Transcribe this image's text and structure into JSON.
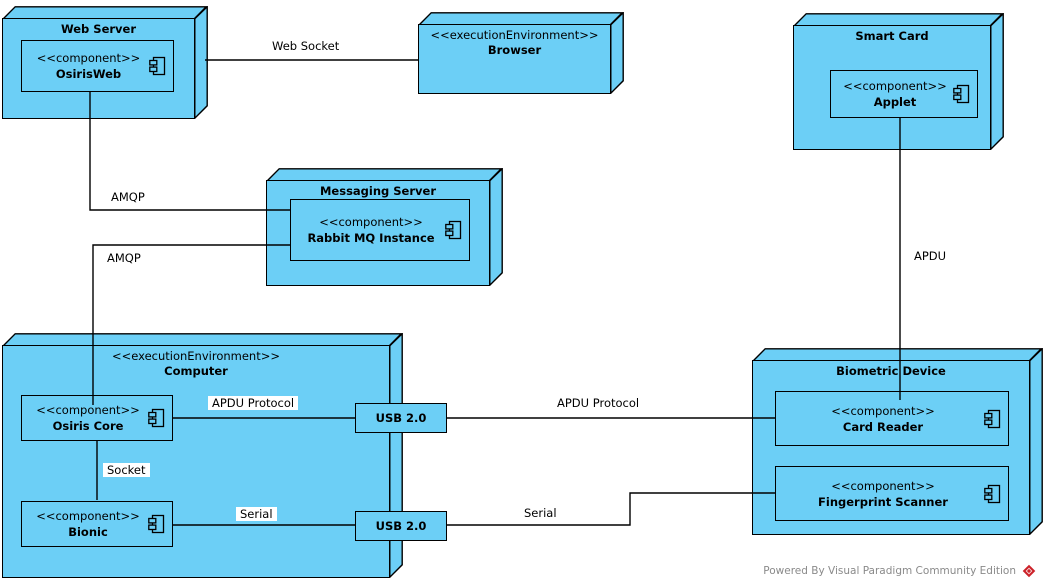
{
  "diagram": {
    "type": "uml-deployment-diagram",
    "watermark": "Powered By Visual Paradigm Community Edition",
    "colors": {
      "node_fill": "#6CCFF6",
      "node_border": "#000000",
      "background": "#FFFFFF",
      "watermark_text": "#8A8A8A",
      "watermark_logo": "#CC2229"
    }
  },
  "nodes": [
    {
      "id": "web-server",
      "stereotype": "",
      "name": "Web Server",
      "component": {
        "stereotype": "<<component>>",
        "name": "OsirisWeb"
      }
    },
    {
      "id": "browser",
      "stereotype": "<<executionEnvironment>>",
      "name": "Browser",
      "component": null
    },
    {
      "id": "smart-card",
      "stereotype": "",
      "name": "Smart Card",
      "component": {
        "stereotype": "<<component>>",
        "name": "Applet"
      }
    },
    {
      "id": "messaging-server",
      "stereotype": "",
      "name": "Messaging Server",
      "component": {
        "stereotype": "<<component>>",
        "name": "Rabbit MQ Instance"
      }
    },
    {
      "id": "computer",
      "stereotype": "<<executionEnvironment>>",
      "name": "Computer",
      "components": [
        {
          "stereotype": "<<component>>",
          "name": "Osiris Core"
        },
        {
          "stereotype": "<<component>>",
          "name": "Bionic"
        }
      ]
    },
    {
      "id": "biometric-device",
      "stereotype": "",
      "name": "Biometric Device",
      "components": [
        {
          "stereotype": "<<component>>",
          "name": "Card Reader"
        },
        {
          "stereotype": "<<component>>",
          "name": "Fingerprint Scanner"
        }
      ]
    }
  ],
  "artifacts": [
    {
      "id": "usb-top",
      "label": "USB 2.0"
    },
    {
      "id": "usb-bottom",
      "label": "USB 2.0"
    }
  ],
  "connections": [
    {
      "id": "web-socket",
      "label": "Web Socket",
      "from": "web-server",
      "to": "browser"
    },
    {
      "id": "amqp-upper",
      "label": "AMQP",
      "from": "web-server",
      "to": "messaging-server"
    },
    {
      "id": "amqp-lower",
      "label": "AMQP",
      "from": "messaging-server",
      "to": "computer"
    },
    {
      "id": "apdu",
      "label": "APDU",
      "from": "smart-card",
      "to": "biometric-device"
    },
    {
      "id": "apdu-protocol-left",
      "label": "APDU Protocol",
      "from": "osiris-core",
      "to": "usb-top"
    },
    {
      "id": "apdu-protocol-right",
      "label": "APDU Protocol",
      "from": "usb-top",
      "to": "card-reader"
    },
    {
      "id": "socket",
      "label": "Socket",
      "from": "osiris-core",
      "to": "bionic"
    },
    {
      "id": "serial-left",
      "label": "Serial",
      "from": "bionic",
      "to": "usb-bottom"
    },
    {
      "id": "serial-right",
      "label": "Serial",
      "from": "usb-bottom",
      "to": "fingerprint-scanner"
    }
  ]
}
